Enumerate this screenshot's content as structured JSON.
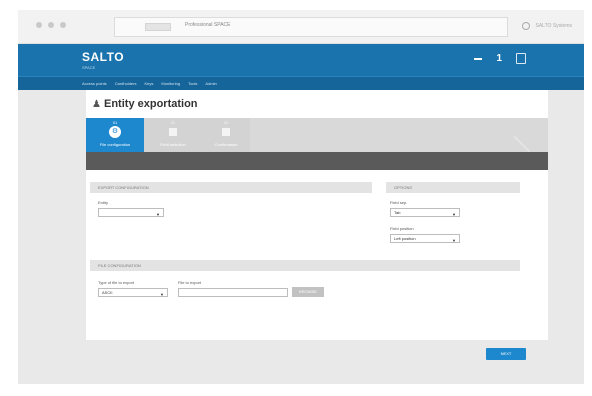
{
  "browser": {
    "address_text": "Professional SPACE",
    "right_text": "SALTO Systems",
    "accent": "#f2f2f2"
  },
  "app": {
    "logo": "SALTO",
    "logo_sub": "SPACE",
    "brand_color": "#1a73ad",
    "topbar_user_icon": "user-icon",
    "topbar_user_count": "1",
    "menu": [
      "Access points",
      "Cardholders",
      "Keys",
      "Monitoring",
      "Tools",
      "Admin"
    ]
  },
  "page": {
    "title": "Entity exportation",
    "title_icon": "users-icon",
    "wizard": [
      {
        "number": "01",
        "label": "File configuration",
        "active": true
      },
      {
        "number": "02",
        "label": "Field selection",
        "active": false
      },
      {
        "number": "03",
        "label": "Confirmation",
        "active": false
      }
    ],
    "export_section": {
      "title": "EXPORT CONFIGURATION",
      "entity_label": "Entity",
      "entity_value": ""
    },
    "options_section": {
      "title": "OPTIONS",
      "field_sep_label": "Field sep.",
      "field_sep_value": "Tab",
      "field_position_label": "Field position",
      "field_position_value": "Left position"
    },
    "file_section": {
      "title": "FILE CONFIGURATION",
      "type_label": "Type of file to export",
      "type_value": "ASCII",
      "file_label": "File to export",
      "file_value": "",
      "browse_button": "BROWSE"
    },
    "next_button": "NEXT"
  }
}
